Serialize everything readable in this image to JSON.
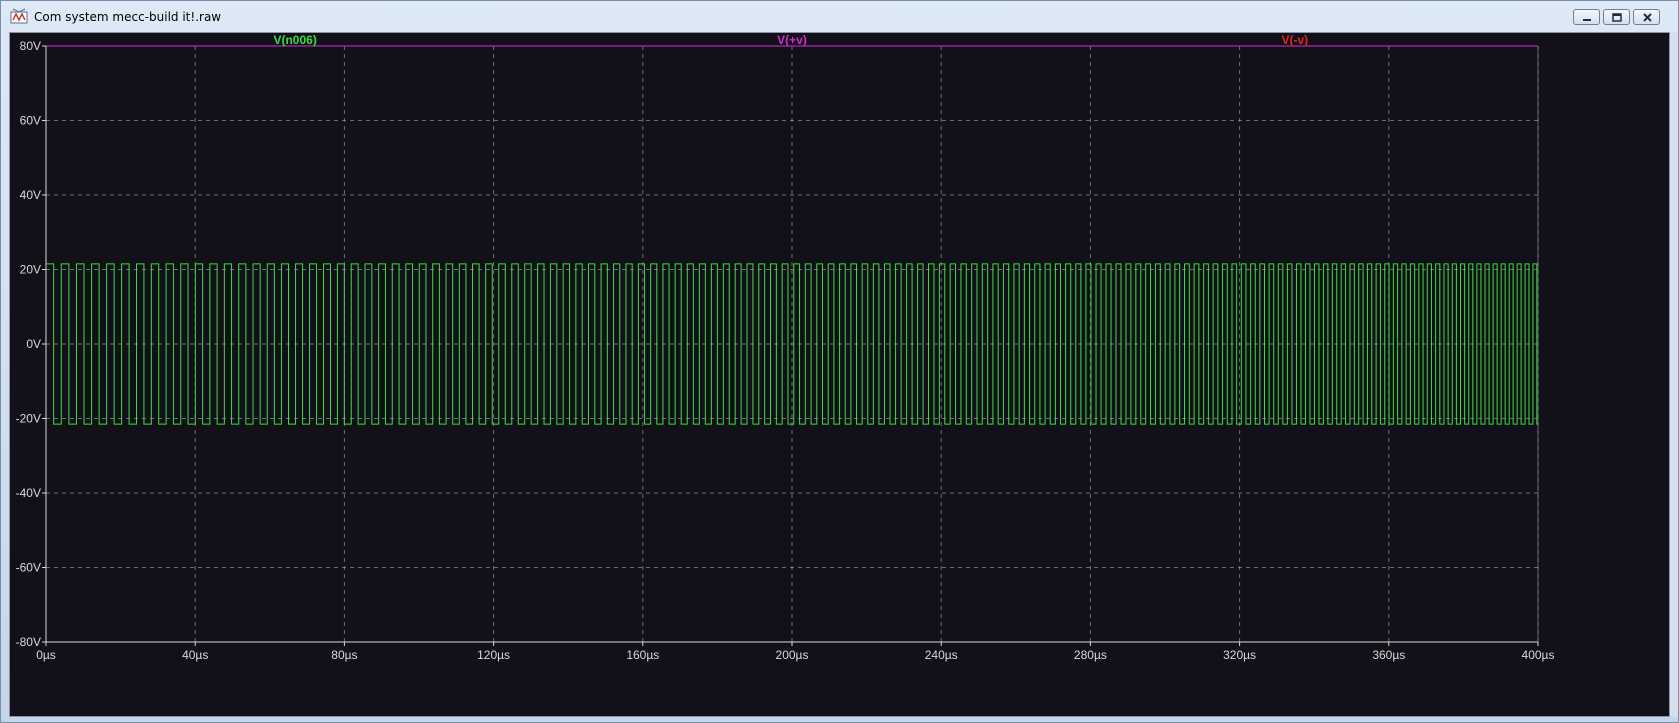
{
  "window": {
    "title": "Com system mecc-build it!.raw",
    "buttons": [
      "minimize",
      "restore",
      "close"
    ]
  },
  "colors": {
    "background": "#12111a",
    "grid": "#8c8c8c",
    "axis": "#d8d8d8",
    "trace_n006": "#3ddc3d",
    "trace_plus_v": "#d22bd2",
    "trace_minus_v": "#e0261e"
  },
  "chart_data": {
    "type": "line",
    "title": "",
    "xlabel": "",
    "ylabel": "",
    "xlim": [
      0,
      400
    ],
    "ylim": [
      -80,
      80
    ],
    "x_unit": "µs",
    "y_unit": "V",
    "grid": true,
    "legend_position": "top",
    "x_ticks": [
      "0µs",
      "40µs",
      "80µs",
      "120µs",
      "160µs",
      "200µs",
      "240µs",
      "280µs",
      "320µs",
      "360µs",
      "400µs"
    ],
    "y_ticks": [
      "80V",
      "60V",
      "40V",
      "20V",
      "0V",
      "-20V",
      "-40V",
      "-60V",
      "-80V"
    ],
    "series": [
      {
        "name": "V(n006)",
        "kind": "square-wave",
        "high": 21.5,
        "low": -21.5,
        "start_period_us": 4.1,
        "end_period_us": 2.1,
        "x_start": 0,
        "x_end": 400
      },
      {
        "name": "V(+v)",
        "kind": "constant",
        "value": 80,
        "x_start": 0,
        "x_end": 400
      },
      {
        "name": "V(-v)",
        "kind": "constant",
        "value": -80,
        "x_start": 0,
        "x_end": 400
      }
    ]
  }
}
